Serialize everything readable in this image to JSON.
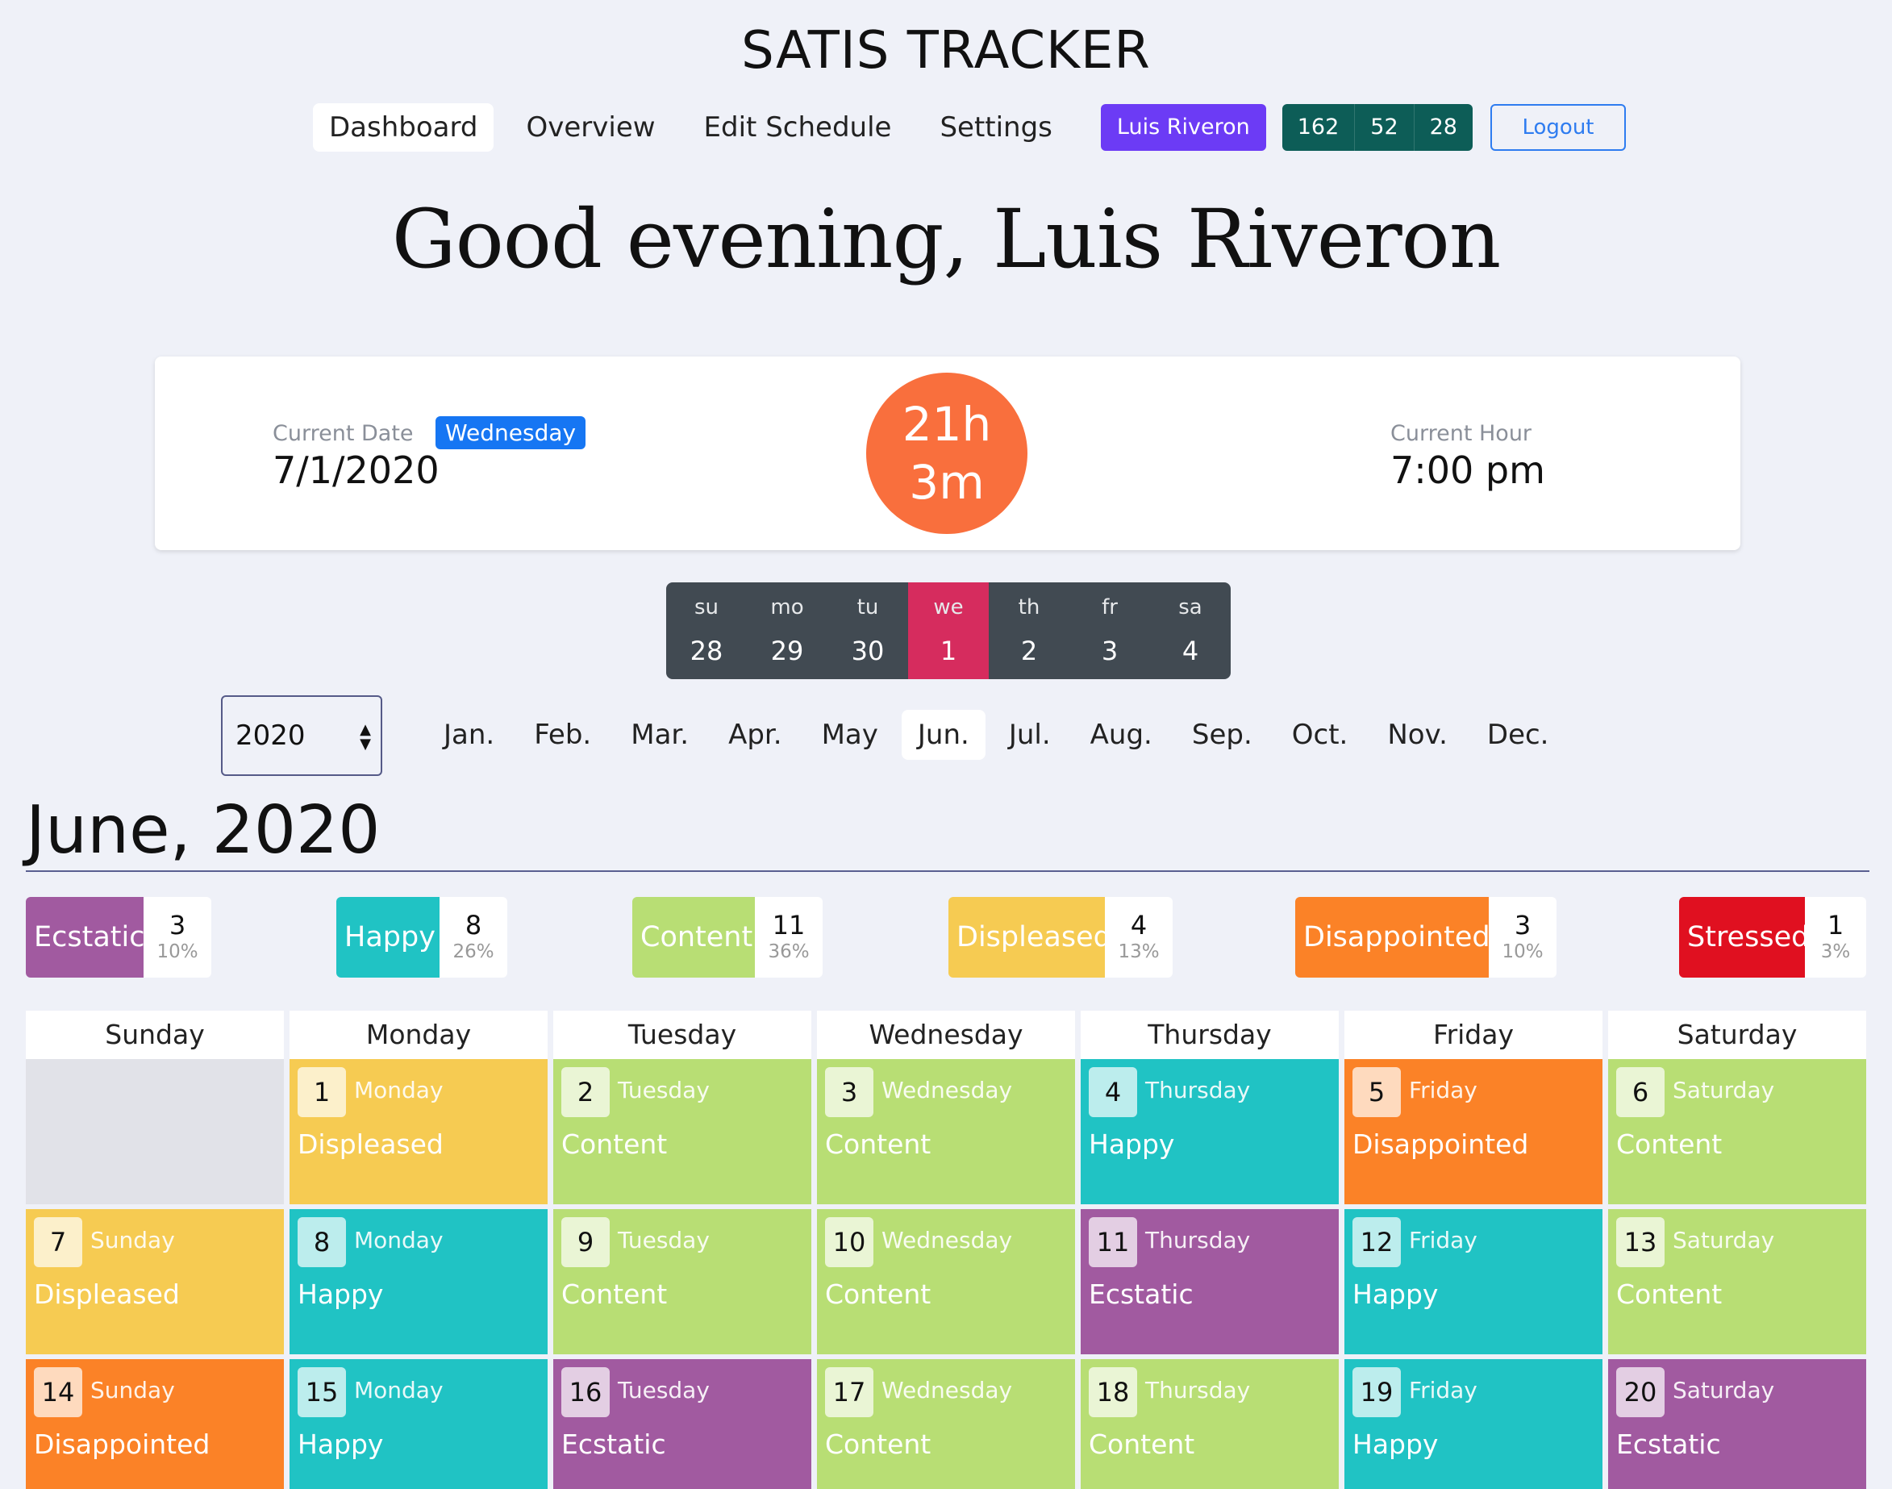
{
  "brand": "SATIS TRACKER",
  "nav": {
    "dashboard": "Dashboard",
    "overview": "Overview",
    "edit_schedule": "Edit Schedule",
    "settings": "Settings",
    "user": "Luis Riveron",
    "stats": [
      "162",
      "52",
      "28"
    ],
    "logout": "Logout"
  },
  "greeting": "Good evening, Luis Riveron",
  "info": {
    "date_label": "Current Date",
    "weekday": "Wednesday",
    "date": "7/1/2020",
    "countdown_hours": "21h",
    "countdown_minutes": "3m",
    "hour_label": "Current Hour",
    "hour": "7:00 pm"
  },
  "week": [
    {
      "name": "su",
      "num": "28"
    },
    {
      "name": "mo",
      "num": "29"
    },
    {
      "name": "tu",
      "num": "30"
    },
    {
      "name": "we",
      "num": "1",
      "today": true
    },
    {
      "name": "th",
      "num": "2"
    },
    {
      "name": "fr",
      "num": "3"
    },
    {
      "name": "sa",
      "num": "4"
    }
  ],
  "year_select": "2020",
  "months": [
    "Jan.",
    "Feb.",
    "Mar.",
    "Apr.",
    "May",
    "Jun.",
    "Jul.",
    "Aug.",
    "Sep.",
    "Oct.",
    "Nov.",
    "Dec."
  ],
  "active_month": "Jun.",
  "month_title": "June, 2020",
  "moods": [
    {
      "name": "Ecstatic",
      "count": "3",
      "pct": "10%",
      "color": "#a15aa0"
    },
    {
      "name": "Happy",
      "count": "8",
      "pct": "26%",
      "color": "#20c3c4"
    },
    {
      "name": "Content",
      "count": "11",
      "pct": "36%",
      "color": "#b8de74"
    },
    {
      "name": "Displeased",
      "count": "4",
      "pct": "13%",
      "color": "#f6cb52"
    },
    {
      "name": "Disappointed",
      "count": "3",
      "pct": "10%",
      "color": "#fb8227"
    },
    {
      "name": "Stressed",
      "count": "1",
      "pct": "3%",
      "color": "#e01020"
    }
  ],
  "weekdays": [
    "Sunday",
    "Monday",
    "Tuesday",
    "Wednesday",
    "Thursday",
    "Friday",
    "Saturday"
  ],
  "days": [
    {
      "num": "1",
      "day": "Monday",
      "mood": "Displeased"
    },
    {
      "num": "2",
      "day": "Tuesday",
      "mood": "Content"
    },
    {
      "num": "3",
      "day": "Wednesday",
      "mood": "Content"
    },
    {
      "num": "4",
      "day": "Thursday",
      "mood": "Happy"
    },
    {
      "num": "5",
      "day": "Friday",
      "mood": "Disappointed"
    },
    {
      "num": "6",
      "day": "Saturday",
      "mood": "Content"
    },
    {
      "num": "7",
      "day": "Sunday",
      "mood": "Displeased"
    },
    {
      "num": "8",
      "day": "Monday",
      "mood": "Happy"
    },
    {
      "num": "9",
      "day": "Tuesday",
      "mood": "Content"
    },
    {
      "num": "10",
      "day": "Wednesday",
      "mood": "Content"
    },
    {
      "num": "11",
      "day": "Thursday",
      "mood": "Ecstatic"
    },
    {
      "num": "12",
      "day": "Friday",
      "mood": "Happy"
    },
    {
      "num": "13",
      "day": "Saturday",
      "mood": "Content"
    },
    {
      "num": "14",
      "day": "Sunday",
      "mood": "Disappointed"
    },
    {
      "num": "15",
      "day": "Monday",
      "mood": "Happy"
    },
    {
      "num": "16",
      "day": "Tuesday",
      "mood": "Ecstatic"
    },
    {
      "num": "17",
      "day": "Wednesday",
      "mood": "Content"
    },
    {
      "num": "18",
      "day": "Thursday",
      "mood": "Content"
    },
    {
      "num": "19",
      "day": "Friday",
      "mood": "Happy"
    },
    {
      "num": "20",
      "day": "Saturday",
      "mood": "Ecstatic"
    }
  ]
}
